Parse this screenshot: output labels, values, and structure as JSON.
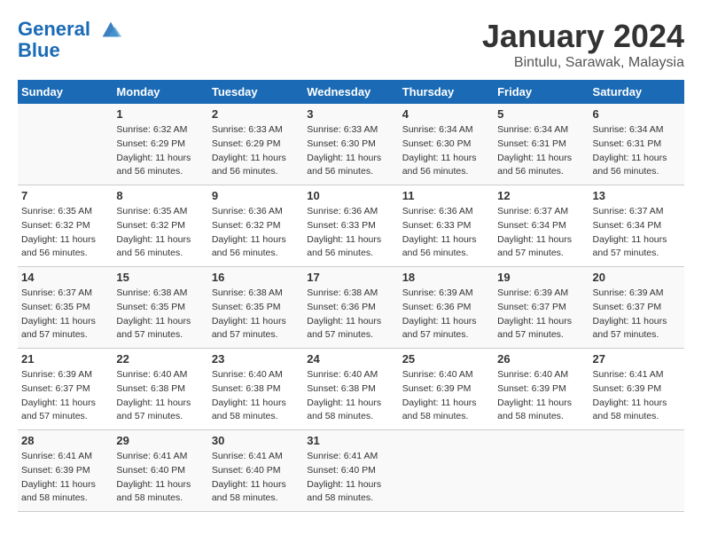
{
  "logo": {
    "line1": "General",
    "line2": "Blue"
  },
  "title": "January 2024",
  "subtitle": "Bintulu, Sarawak, Malaysia",
  "columns": [
    "Sunday",
    "Monday",
    "Tuesday",
    "Wednesday",
    "Thursday",
    "Friday",
    "Saturday"
  ],
  "weeks": [
    [
      {
        "day": "",
        "info": ""
      },
      {
        "day": "1",
        "info": "Sunrise: 6:32 AM\nSunset: 6:29 PM\nDaylight: 11 hours\nand 56 minutes."
      },
      {
        "day": "2",
        "info": "Sunrise: 6:33 AM\nSunset: 6:29 PM\nDaylight: 11 hours\nand 56 minutes."
      },
      {
        "day": "3",
        "info": "Sunrise: 6:33 AM\nSunset: 6:30 PM\nDaylight: 11 hours\nand 56 minutes."
      },
      {
        "day": "4",
        "info": "Sunrise: 6:34 AM\nSunset: 6:30 PM\nDaylight: 11 hours\nand 56 minutes."
      },
      {
        "day": "5",
        "info": "Sunrise: 6:34 AM\nSunset: 6:31 PM\nDaylight: 11 hours\nand 56 minutes."
      },
      {
        "day": "6",
        "info": "Sunrise: 6:34 AM\nSunset: 6:31 PM\nDaylight: 11 hours\nand 56 minutes."
      }
    ],
    [
      {
        "day": "7",
        "info": "Sunrise: 6:35 AM\nSunset: 6:32 PM\nDaylight: 11 hours\nand 56 minutes."
      },
      {
        "day": "8",
        "info": "Sunrise: 6:35 AM\nSunset: 6:32 PM\nDaylight: 11 hours\nand 56 minutes."
      },
      {
        "day": "9",
        "info": "Sunrise: 6:36 AM\nSunset: 6:32 PM\nDaylight: 11 hours\nand 56 minutes."
      },
      {
        "day": "10",
        "info": "Sunrise: 6:36 AM\nSunset: 6:33 PM\nDaylight: 11 hours\nand 56 minutes."
      },
      {
        "day": "11",
        "info": "Sunrise: 6:36 AM\nSunset: 6:33 PM\nDaylight: 11 hours\nand 56 minutes."
      },
      {
        "day": "12",
        "info": "Sunrise: 6:37 AM\nSunset: 6:34 PM\nDaylight: 11 hours\nand 57 minutes."
      },
      {
        "day": "13",
        "info": "Sunrise: 6:37 AM\nSunset: 6:34 PM\nDaylight: 11 hours\nand 57 minutes."
      }
    ],
    [
      {
        "day": "14",
        "info": "Sunrise: 6:37 AM\nSunset: 6:35 PM\nDaylight: 11 hours\nand 57 minutes."
      },
      {
        "day": "15",
        "info": "Sunrise: 6:38 AM\nSunset: 6:35 PM\nDaylight: 11 hours\nand 57 minutes."
      },
      {
        "day": "16",
        "info": "Sunrise: 6:38 AM\nSunset: 6:35 PM\nDaylight: 11 hours\nand 57 minutes."
      },
      {
        "day": "17",
        "info": "Sunrise: 6:38 AM\nSunset: 6:36 PM\nDaylight: 11 hours\nand 57 minutes."
      },
      {
        "day": "18",
        "info": "Sunrise: 6:39 AM\nSunset: 6:36 PM\nDaylight: 11 hours\nand 57 minutes."
      },
      {
        "day": "19",
        "info": "Sunrise: 6:39 AM\nSunset: 6:37 PM\nDaylight: 11 hours\nand 57 minutes."
      },
      {
        "day": "20",
        "info": "Sunrise: 6:39 AM\nSunset: 6:37 PM\nDaylight: 11 hours\nand 57 minutes."
      }
    ],
    [
      {
        "day": "21",
        "info": "Sunrise: 6:39 AM\nSunset: 6:37 PM\nDaylight: 11 hours\nand 57 minutes."
      },
      {
        "day": "22",
        "info": "Sunrise: 6:40 AM\nSunset: 6:38 PM\nDaylight: 11 hours\nand 57 minutes."
      },
      {
        "day": "23",
        "info": "Sunrise: 6:40 AM\nSunset: 6:38 PM\nDaylight: 11 hours\nand 58 minutes."
      },
      {
        "day": "24",
        "info": "Sunrise: 6:40 AM\nSunset: 6:38 PM\nDaylight: 11 hours\nand 58 minutes."
      },
      {
        "day": "25",
        "info": "Sunrise: 6:40 AM\nSunset: 6:39 PM\nDaylight: 11 hours\nand 58 minutes."
      },
      {
        "day": "26",
        "info": "Sunrise: 6:40 AM\nSunset: 6:39 PM\nDaylight: 11 hours\nand 58 minutes."
      },
      {
        "day": "27",
        "info": "Sunrise: 6:41 AM\nSunset: 6:39 PM\nDaylight: 11 hours\nand 58 minutes."
      }
    ],
    [
      {
        "day": "28",
        "info": "Sunrise: 6:41 AM\nSunset: 6:39 PM\nDaylight: 11 hours\nand 58 minutes."
      },
      {
        "day": "29",
        "info": "Sunrise: 6:41 AM\nSunset: 6:40 PM\nDaylight: 11 hours\nand 58 minutes."
      },
      {
        "day": "30",
        "info": "Sunrise: 6:41 AM\nSunset: 6:40 PM\nDaylight: 11 hours\nand 58 minutes."
      },
      {
        "day": "31",
        "info": "Sunrise: 6:41 AM\nSunset: 6:40 PM\nDaylight: 11 hours\nand 58 minutes."
      },
      {
        "day": "",
        "info": ""
      },
      {
        "day": "",
        "info": ""
      },
      {
        "day": "",
        "info": ""
      }
    ]
  ]
}
